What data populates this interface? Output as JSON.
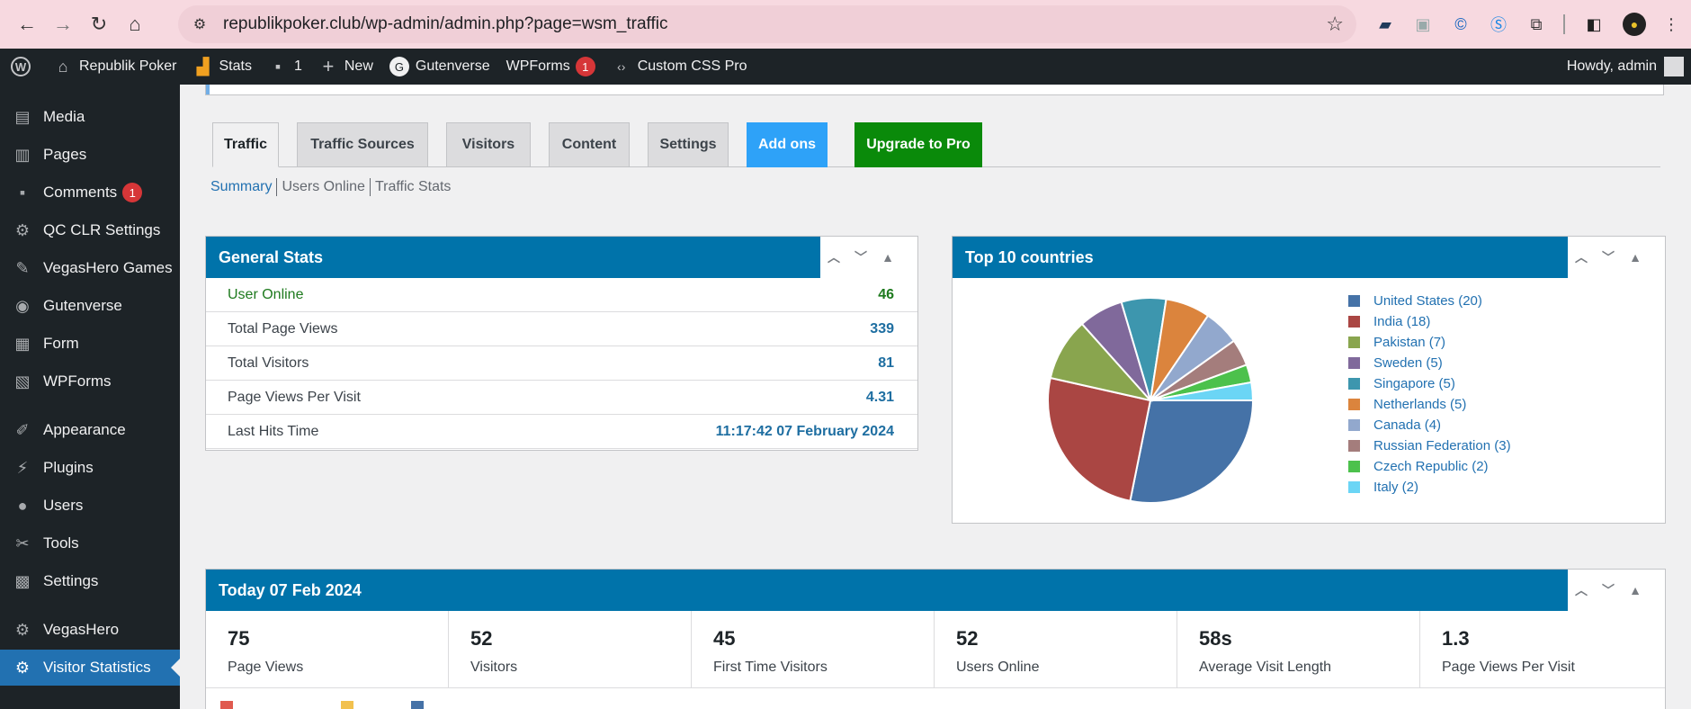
{
  "browser": {
    "url": "republikpoker.club/wp-admin/admin.php?page=wsm_traffic",
    "back_icon": "arrow-left-icon",
    "forward_icon": "arrow-right-icon",
    "reload_icon": "reload-icon",
    "home_icon": "home-icon"
  },
  "adminbar": {
    "site_name": "Republik Poker",
    "stats": "Stats",
    "comments_count": "1",
    "new": "New",
    "gutenverse": "Gutenverse",
    "wpforms": "WPForms",
    "wpforms_badge": "1",
    "custom_css": "Custom CSS Pro",
    "howdy": "Howdy, admin"
  },
  "sidebar": {
    "items": [
      {
        "label": "Media",
        "icon": "media-icon"
      },
      {
        "label": "Pages",
        "icon": "pages-icon"
      },
      {
        "label": "Comments",
        "icon": "comments-icon",
        "badge": "1"
      },
      {
        "label": "QC CLR Settings",
        "icon": "gear-icon"
      },
      {
        "label": "VegasHero Games",
        "icon": "pin-icon"
      },
      {
        "label": "Gutenverse",
        "icon": "gutenverse-icon"
      },
      {
        "label": "Form",
        "icon": "form-icon"
      },
      {
        "label": "WPForms",
        "icon": "wpforms-icon"
      },
      {
        "label": "Appearance",
        "icon": "brush-icon"
      },
      {
        "label": "Plugins",
        "icon": "plugin-icon"
      },
      {
        "label": "Users",
        "icon": "user-icon"
      },
      {
        "label": "Tools",
        "icon": "wrench-icon"
      },
      {
        "label": "Settings",
        "icon": "settings-icon"
      },
      {
        "label": "VegasHero",
        "icon": "gear-icon"
      },
      {
        "label": "Visitor Statistics",
        "icon": "gear-icon",
        "active": true
      }
    ]
  },
  "tabs": [
    "Traffic",
    "Traffic Sources",
    "Visitors",
    "Content",
    "Settings",
    "Add ons",
    "Upgrade to Pro"
  ],
  "subnav": [
    "Summary",
    "Users Online",
    "Traffic Stats"
  ],
  "general_stats": {
    "title": "General Stats",
    "rows": [
      {
        "label": "User Online",
        "value": "46"
      },
      {
        "label": "Total Page Views",
        "value": "339"
      },
      {
        "label": "Total Visitors",
        "value": "81"
      },
      {
        "label": "Page Views Per Visit",
        "value": "4.31"
      },
      {
        "label": "Last Hits Time",
        "value": "11:17:42 07 February 2024"
      }
    ]
  },
  "countries": {
    "title": "Top 10 countries"
  },
  "chart_data": {
    "type": "pie",
    "title": "Top 10 countries",
    "categories": [
      "United States",
      "India",
      "Pakistan",
      "Sweden",
      "Singapore",
      "Netherlands",
      "Canada",
      "Russian Federation",
      "Czech Republic",
      "Italy"
    ],
    "values": [
      20,
      18,
      7,
      5,
      5,
      5,
      4,
      3,
      2,
      2
    ],
    "legend_labels": [
      "United States (20)",
      "India (18)",
      "Pakistan (7)",
      "Sweden (5)",
      "Singapore (5)",
      "Netherlands (5)",
      "Canada (4)",
      "Russian Federation (3)",
      "Czech Republic (2)",
      "Italy (2)"
    ],
    "colors": [
      "#4572a7",
      "#aa4643",
      "#89a54e",
      "#80699b",
      "#3d96ae",
      "#db843d",
      "#92a8cd",
      "#a47d7c",
      "#4cc14c",
      "#6bd5f5"
    ],
    "legend": "right"
  },
  "today": {
    "title": "Today  07 Feb 2024",
    "cells": [
      {
        "value": "75",
        "label": "Page Views"
      },
      {
        "value": "52",
        "label": "Visitors"
      },
      {
        "value": "45",
        "label": "First Time Visitors"
      },
      {
        "value": "52",
        "label": "Users Online"
      },
      {
        "value": "58s",
        "label": "Average Visit Length"
      },
      {
        "value": "1.3",
        "label": "Page Views Per Visit"
      }
    ]
  },
  "controls": {
    "up": "▲",
    "down": "▼",
    "expand": "▲"
  }
}
